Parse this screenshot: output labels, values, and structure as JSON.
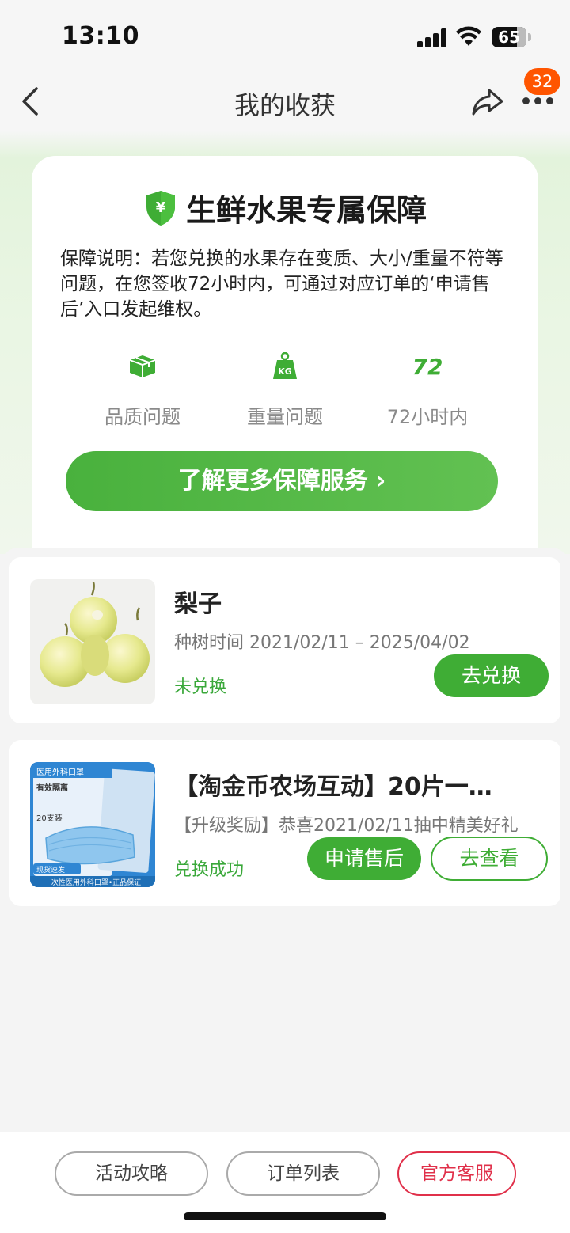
{
  "status_bar": {
    "time": "13:10",
    "battery": "65"
  },
  "nav": {
    "title": "我的收获",
    "badge_count": "32"
  },
  "guarantee": {
    "title": "生鲜水果专属保障",
    "description": "保障说明：若您兑换的水果存在变质、大小/重量不符等问题，在您签收72小时内，可通过对应订单的‘申请售后’入口发起维权。",
    "features": [
      {
        "icon": "box-icon",
        "label": "品质问题"
      },
      {
        "icon": "kg-weight-icon",
        "label": "重量问题"
      },
      {
        "icon": "72-icon",
        "icon_text": "72",
        "label": "72小时内"
      }
    ],
    "button": "了解更多保障服务 ›"
  },
  "items": [
    {
      "title": "梨子",
      "subtitle": "种树时间 2021/02/11 – 2025/04/02",
      "status": "未兑换",
      "primary_button": "去兑换"
    },
    {
      "title": "【淘金币农场互动】20片一…",
      "subtitle": "【升级奖励】恭喜2021/02/11抽中精美好礼",
      "status": "兑换成功",
      "primary_button": "申请售后",
      "secondary_button": "去查看",
      "image_texts": {
        "line1": "医用外科口罩",
        "line2": "有效隔离",
        "line3": "20支装",
        "line4": "现货速发",
        "footer": "一次性医用外科口罩•正品保证"
      }
    }
  ],
  "bottom_bar": {
    "buttons": [
      "活动攻略",
      "订单列表",
      "官方客服"
    ]
  },
  "colors": {
    "green": "#3fad35",
    "red": "#e0304a",
    "orange_badge": "#ff5500"
  }
}
